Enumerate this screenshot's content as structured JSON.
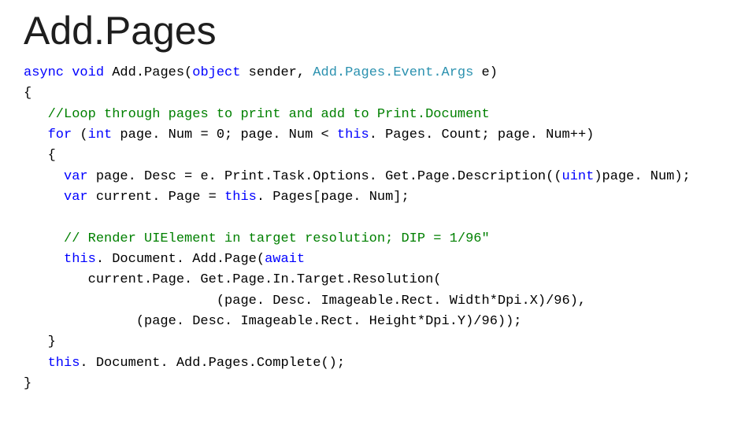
{
  "title": "Add.Pages",
  "code": {
    "l1": {
      "a": "async",
      "b": " ",
      "c": "void",
      "d": " Add.Pages(",
      "e": "object",
      "f": " sender, ",
      "g": "Add.Pages.Event.Args",
      "h": " e)"
    },
    "l2": "{",
    "l3": {
      "a": "   ",
      "b": "//Loop through pages to print and add to Print.Document"
    },
    "l4": {
      "a": "   ",
      "b": "for",
      "c": " (",
      "d": "int",
      "e": " page. Num = 0; page. Num < ",
      "f": "this",
      "g": ". Pages. Count; page. Num++)"
    },
    "l5": "   {",
    "l6": {
      "a": "     ",
      "b": "var",
      "c": " page. Desc = e. Print.Task.Options. Get.Page.Description((",
      "d": "uint",
      "e": ")page. Num);"
    },
    "l7": {
      "a": "     ",
      "b": "var",
      "c": " current. Page = ",
      "d": "this",
      "e": ". Pages[page. Num];"
    },
    "l8": "",
    "l9": {
      "a": "     ",
      "b": "// Render UIElement in target resolution; DIP = 1/96\""
    },
    "l10": {
      "a": "     ",
      "b": "this",
      "c": ". Document. Add.Page(",
      "d": "await"
    },
    "l11": "        current.Page. Get.Page.In.Target.Resolution(",
    "l12": "                        (page. Desc. Imageable.Rect. Width*Dpi.X)/96),",
    "l13": "              (page. Desc. Imageable.Rect. Height*Dpi.Y)/96));",
    "l14": "   }",
    "l15": {
      "a": "   ",
      "b": "this",
      "c": ". Document. Add.Pages.Complete();"
    },
    "l16": "}"
  }
}
